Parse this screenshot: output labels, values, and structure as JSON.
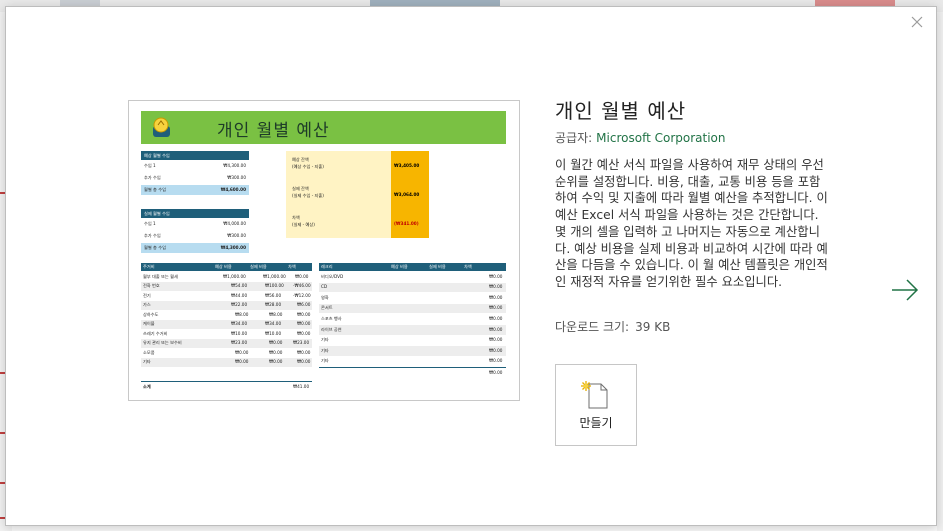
{
  "dialog": {
    "close_label": "×",
    "next_arrow": "→"
  },
  "template": {
    "title": "개인 월별 예산",
    "provider_label": "공급자:",
    "provider_name": "Microsoft Corporation",
    "description": "이 월간 예산 서식 파일을 사용하여 재무 상태의 우선 순위를 설정합니다. 비용, 대출, 교통 비용 등을 포함하여 수익 및 지출에 따라 월별 예산을 추적합니다. 이 예산 Excel 서식 파일을 사용하는 것은 간단합니다. 몇 개의 셀을 입력하 고 나머지는 자동으로 계산합니다. 예상 비용을 실제 비용과 비교하여 시간에 따라 예산을 다듬을 수 있습니다. 이 월 예산 템플릿은 개인적인 재정적 자유를 얻기위한 필수 요소입니다.",
    "download_label": "다운로드 크기:",
    "download_size": "39 KB",
    "create_label": "만들기"
  },
  "preview": {
    "banner_title": "개인 월별 예산",
    "expected_income": {
      "header": "예상 월별 수입",
      "rows": [
        {
          "label": "수입 1",
          "value": "₩4,300.00"
        },
        {
          "label": "추가 수입",
          "value": "₩300.00"
        },
        {
          "label": "월별 총 수입",
          "value": "₩4,600.00"
        }
      ]
    },
    "actual_income": {
      "header": "실제 월별 수입",
      "rows": [
        {
          "label": "수입 1",
          "value": "₩4,000.00"
        },
        {
          "label": "추가 수입",
          "value": "₩300.00"
        },
        {
          "label": "월별 총 수입",
          "value": "₩4,300.00"
        }
      ]
    },
    "summary": [
      {
        "label1": "예상 잔액",
        "label2": "(예상 수입 - 지출)",
        "value": "₩3,405.00",
        "negative": false
      },
      {
        "label1": "실제 잔액",
        "label2": "(실제 수입 - 지출)",
        "value": "₩3,064.00",
        "negative": false
      },
      {
        "label1": "차액",
        "label2": "(실제 - 예상)",
        "value": "(₩341.00)",
        "negative": true
      }
    ],
    "housing_table": {
      "headers": [
        "주거비",
        "예상 비용",
        "실제 비용",
        "차액"
      ],
      "rows": [
        [
          "월부 대출 또는 월세",
          "₩1,000.00",
          "₩1,000.00",
          "₩0.00"
        ],
        [
          "전화 번호",
          "₩54.00",
          "₩100.00",
          "-₩46.00"
        ],
        [
          "전기",
          "₩44.00",
          "₩56.00",
          "-₩12.00"
        ],
        [
          "가스",
          "₩22.00",
          "₩28.00",
          "₩6.00"
        ],
        [
          "상하수도",
          "₩8.00",
          "₩8.00",
          "₩0.00"
        ],
        [
          "케이블",
          "₩34.00",
          "₩34.00",
          "₩0.00"
        ],
        [
          "쓰레기 수거비",
          "₩10.00",
          "₩10.00",
          "₩0.00"
        ],
        [
          "유지 관리 또는 보수비",
          "₩23.00",
          "₩0.00",
          "₩23.00"
        ],
        [
          "소모품",
          "₩0.00",
          "₩0.00",
          "₩0.00"
        ],
        [
          "기타",
          "₩0.00",
          "₩0.00",
          "₩0.00"
        ]
      ],
      "total_label": "소계",
      "total_value": "₩41.00"
    },
    "entertainment_table": {
      "headers": [
        "레크리",
        "예상 비용",
        "실제 비용",
        "차액"
      ],
      "rows": [
        [
          "비디오/DVD",
          "₩0.00"
        ],
        [
          "CD",
          "₩0.00"
        ],
        [
          "영화",
          "₩0.00"
        ],
        [
          "콘서트",
          "₩0.00"
        ],
        [
          "스포츠 행사",
          "₩0.00"
        ],
        [
          "라이브 공연",
          "₩0.00"
        ],
        [
          "기타",
          "₩0.00"
        ],
        [
          "기타",
          "₩0.00"
        ],
        [
          "기타",
          "₩0.00"
        ]
      ],
      "total_value": "₩0.00"
    }
  },
  "colors": {
    "banner": "#7ac143",
    "header_blue": "#1f5f7a",
    "summary_bg": "#fff3c4",
    "summary_value": "#f7b500",
    "accent_link": "#217346"
  }
}
